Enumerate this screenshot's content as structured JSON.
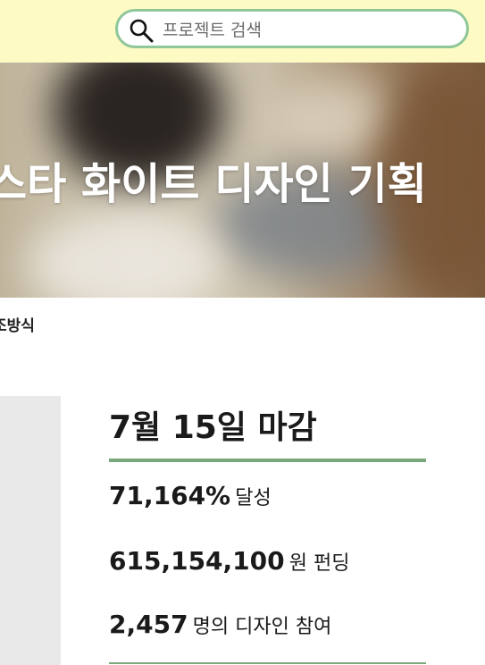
{
  "search": {
    "placeholder": "프로젝트 검색",
    "icon": "search-icon"
  },
  "hero": {
    "title": "스타 화이트 디자인 기획"
  },
  "subinfo": "조방식",
  "campaign": {
    "deadline": "7월 15일 마감",
    "achievement": {
      "value": "71,164%",
      "unit": "달성"
    },
    "funding": {
      "value": "615,154,100",
      "unit": "원 펀딩"
    },
    "participants": {
      "value": "2,457",
      "unit": "명의 디자인 참여"
    }
  },
  "colors": {
    "topbar": "#fdfac4",
    "search_border": "#8fc79a",
    "accent_rule": "#78a87c",
    "side_panel": "#e9e9e9"
  }
}
